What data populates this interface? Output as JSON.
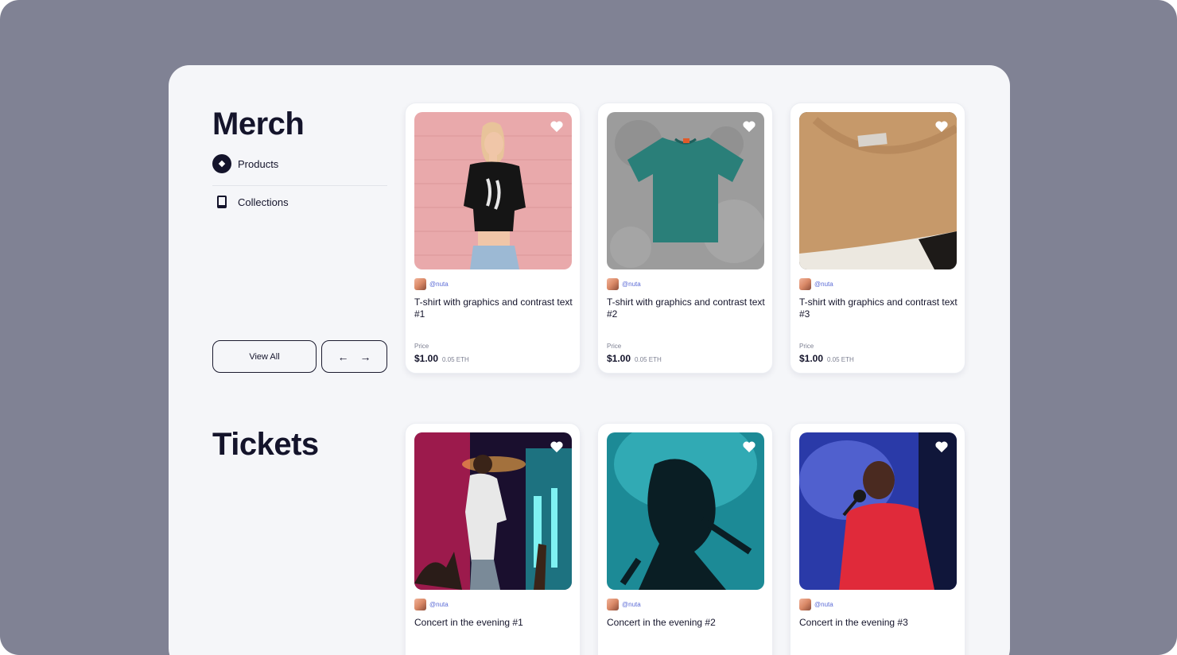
{
  "merch": {
    "title": "Merch",
    "nav": [
      {
        "label": "Products",
        "active": true
      },
      {
        "label": "Collections",
        "active": false
      }
    ],
    "view_all_label": "View All",
    "prev_arrow": "←",
    "next_arrow": "→",
    "products": [
      {
        "creator": "@nuta",
        "title": "T-shirt with graphics and contrast text #1",
        "price_label": "Price",
        "price": "$1.00",
        "eth": "0.05 ETH"
      },
      {
        "creator": "@nuta",
        "title": "T-shirt with graphics and contrast text #2",
        "price_label": "Price",
        "price": "$1.00",
        "eth": "0.05 ETH"
      },
      {
        "creator": "@nuta",
        "title": "T-shirt with graphics and contrast text #3",
        "price_label": "Price",
        "price": "$1.00",
        "eth": "0.05 ETH"
      }
    ]
  },
  "tickets": {
    "title": "Tickets",
    "items": [
      {
        "creator": "@nuta",
        "title": "Concert in the evening #1"
      },
      {
        "creator": "@nuta",
        "title": "Concert in the evening #2"
      },
      {
        "creator": "@nuta",
        "title": "Concert in the evening #3"
      }
    ]
  },
  "colors": {
    "outer_background": "#808294",
    "panel_background": "#f5f6f9",
    "text_dark": "#14142b",
    "creator_link": "#5b6bd6"
  }
}
